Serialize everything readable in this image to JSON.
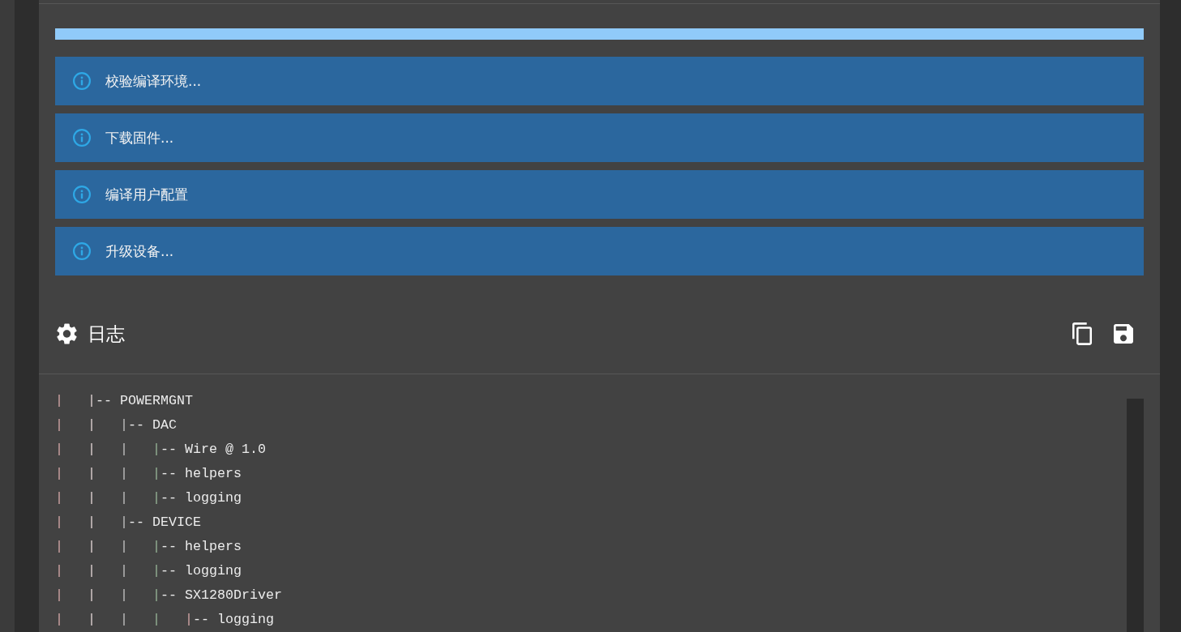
{
  "progress": {
    "level": 1
  },
  "alerts": [
    {
      "text": "校验编译环境..."
    },
    {
      "text": "下载固件..."
    },
    {
      "text": "编译用户配置"
    },
    {
      "text": "升级设备..."
    }
  ],
  "log": {
    "title": "日志",
    "lines": [
      "|   |-- POWERMGNT",
      "|   |   |-- DAC",
      "|   |   |   |-- Wire @ 1.0",
      "|   |   |   |-- helpers",
      "|   |   |   |-- logging",
      "|   |   |-- DEVICE",
      "|   |   |   |-- helpers",
      "|   |   |   |-- logging",
      "|   |   |   |-- SX1280Driver",
      "|   |   |   |   |-- logging"
    ]
  }
}
